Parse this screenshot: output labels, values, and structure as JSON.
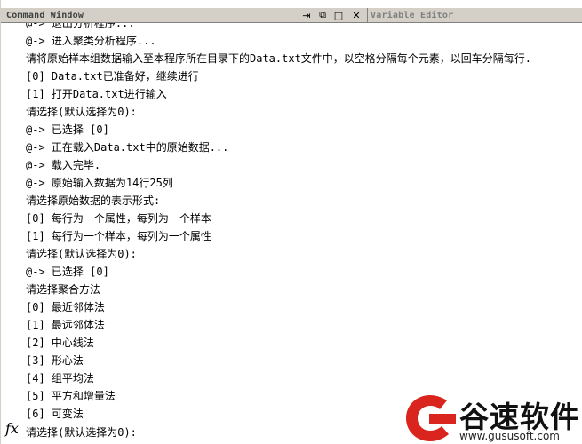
{
  "window": {
    "title": "Command Window",
    "other_tab": "Variable Editor",
    "buttons": {
      "dock": "⇥",
      "undock": "⧉",
      "maximize": "□",
      "close": "✕"
    }
  },
  "console": {
    "cut_top": "@-> 退出分析程序...",
    "lines": [
      " @-> 进入聚类分析程序...",
      "请将原始样本组数据输入至本程序所在目录下的Data.txt文件中，以空格分隔每个元素，以回车分隔每行.",
      "    [0] Data.txt已准备好，继续进行",
      "    [1] 打开Data.txt进行输入",
      "请选择(默认选择为0):",
      "@-> 已选择 [0]",
      "@-> 正在载入Data.txt中的原始数据...",
      "@-> 载入完毕.",
      "@-> 原始输入数据为14行25列",
      "请选择原始数据的表示形式:",
      "    [0] 每行为一个属性，每列为一个样本",
      "    [1] 每行为一个样本，每列为一个属性",
      "请选择(默认选择为0):",
      "@-> 已选择 [0]",
      "请选择聚合方法",
      "    [0] 最近邻体法",
      "    [1] 最远邻体法",
      "    [2] 中心线法",
      "    [3] 形心法",
      "    [4] 组平均法",
      "    [5] 平方和增量法",
      "    [6] 可变法"
    ],
    "prompt": "请选择(默认选择为0):",
    "fx_label": "fx"
  },
  "watermark": {
    "brand": "谷速软件",
    "url": "www.gususoft.com"
  },
  "colors": {
    "title_bg": "#d4d0c8",
    "logo_red": "#d9251d",
    "text": "#000000"
  }
}
